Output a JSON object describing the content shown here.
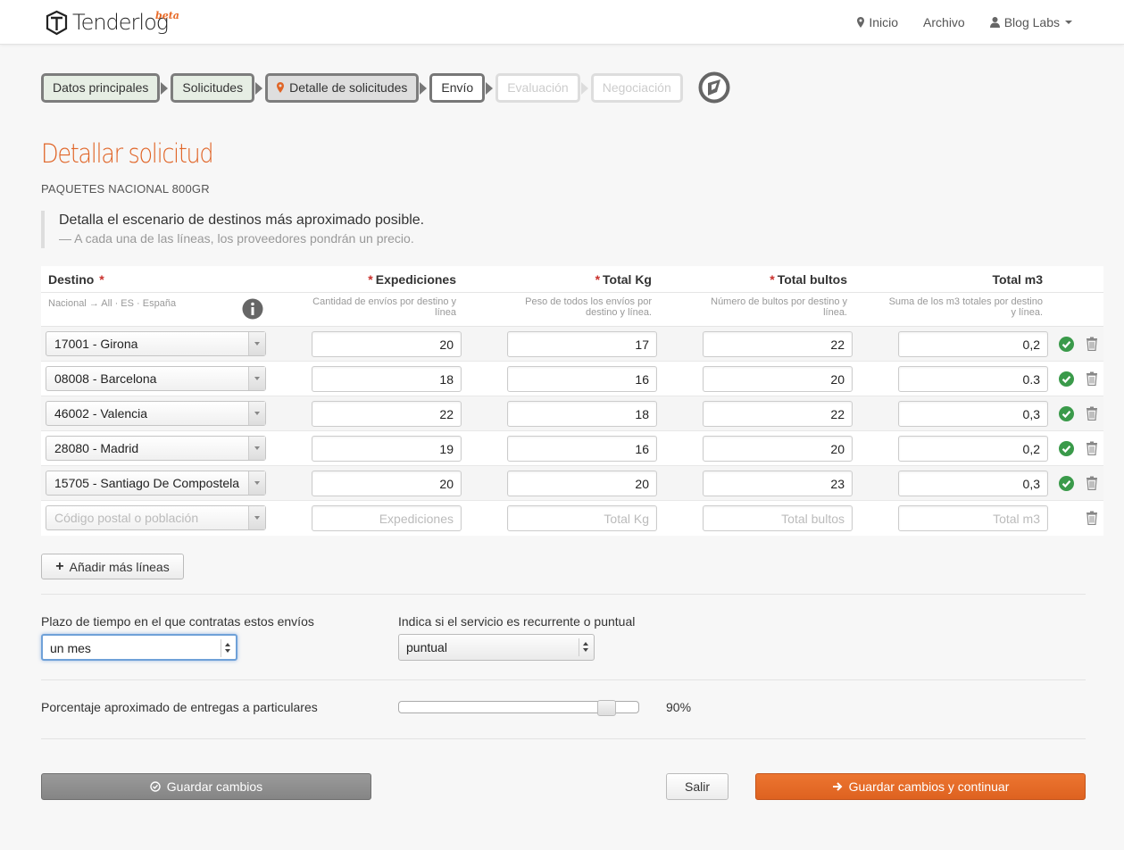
{
  "brand": {
    "name": "Tenderlog",
    "badge": "beta"
  },
  "nav": {
    "items": [
      {
        "label": "Inicio",
        "icon": "map-marker-icon"
      },
      {
        "label": "Archivo"
      },
      {
        "label": "Blog Labs",
        "icon": "user-icon",
        "dropdown": true
      }
    ]
  },
  "steps": [
    {
      "label": "Datos principales",
      "state": "done"
    },
    {
      "label": "Solicitudes",
      "state": "done"
    },
    {
      "label": "Detalle de solicitudes",
      "state": "current"
    },
    {
      "label": "Envío",
      "state": "pending"
    },
    {
      "label": "Evaluación",
      "state": "disabled"
    },
    {
      "label": "Negociación",
      "state": "disabled"
    }
  ],
  "page": {
    "title": "Detallar solicitud",
    "subtitle": "PAQUETES NACIONAL 800GR",
    "quote_main": "Detalla el escenario de destinos más aproximado posible.",
    "quote_sub": "— A cada una de las líneas, los proveedores pondrán un precio."
  },
  "table": {
    "headers": {
      "destino": "Destino",
      "expediciones": "Expediciones",
      "total_kg": "Total Kg",
      "total_bultos": "Total bultos",
      "total_m3": "Total m3"
    },
    "subheaders": {
      "destino": "Nacional → All · ES · España",
      "expediciones": "Cantidad de envíos por destino y línea",
      "total_kg": "Peso de todos los envíos por destino y línea.",
      "total_bultos": "Número de bultos por destino y línea.",
      "total_m3": "Suma de los m3 totales por destino y línea."
    },
    "rows": [
      {
        "destino": "17001 - Girona",
        "expediciones": "20",
        "kg": "17",
        "bultos": "22",
        "m3": "0,2"
      },
      {
        "destino": "08008 - Barcelona",
        "expediciones": "18",
        "kg": "16",
        "bultos": "20",
        "m3": "0.3"
      },
      {
        "destino": "46002 - Valencia",
        "expediciones": "22",
        "kg": "18",
        "bultos": "22",
        "m3": "0,3"
      },
      {
        "destino": "28080 - Madrid",
        "expediciones": "19",
        "kg": "16",
        "bultos": "20",
        "m3": "0,2"
      },
      {
        "destino": "15705 - Santiago De Compostela",
        "expediciones": "20",
        "kg": "20",
        "bultos": "23",
        "m3": "0,3"
      }
    ],
    "new_row_placeholders": {
      "destino": "Código postal o población",
      "expediciones": "Expediciones",
      "kg": "Total Kg",
      "bultos": "Total bultos",
      "m3": "Total m3"
    }
  },
  "add_lines_label": "Añadir más líneas",
  "period": {
    "label": "Plazo de tiempo en el que contratas estos envíos",
    "value": "un mes"
  },
  "recurrence": {
    "label": "Indica si el servicio es recurrente o puntual",
    "value": "puntual"
  },
  "percentage": {
    "label": "Porcentaje aproximado de entregas a particulares",
    "value": 90,
    "value_text": "90%"
  },
  "buttons": {
    "save": "Guardar cambios",
    "exit": "Salir",
    "save_continue": "Guardar cambios y continuar"
  },
  "colors": {
    "accent": "#e06426",
    "success": "#3a9a4a"
  }
}
